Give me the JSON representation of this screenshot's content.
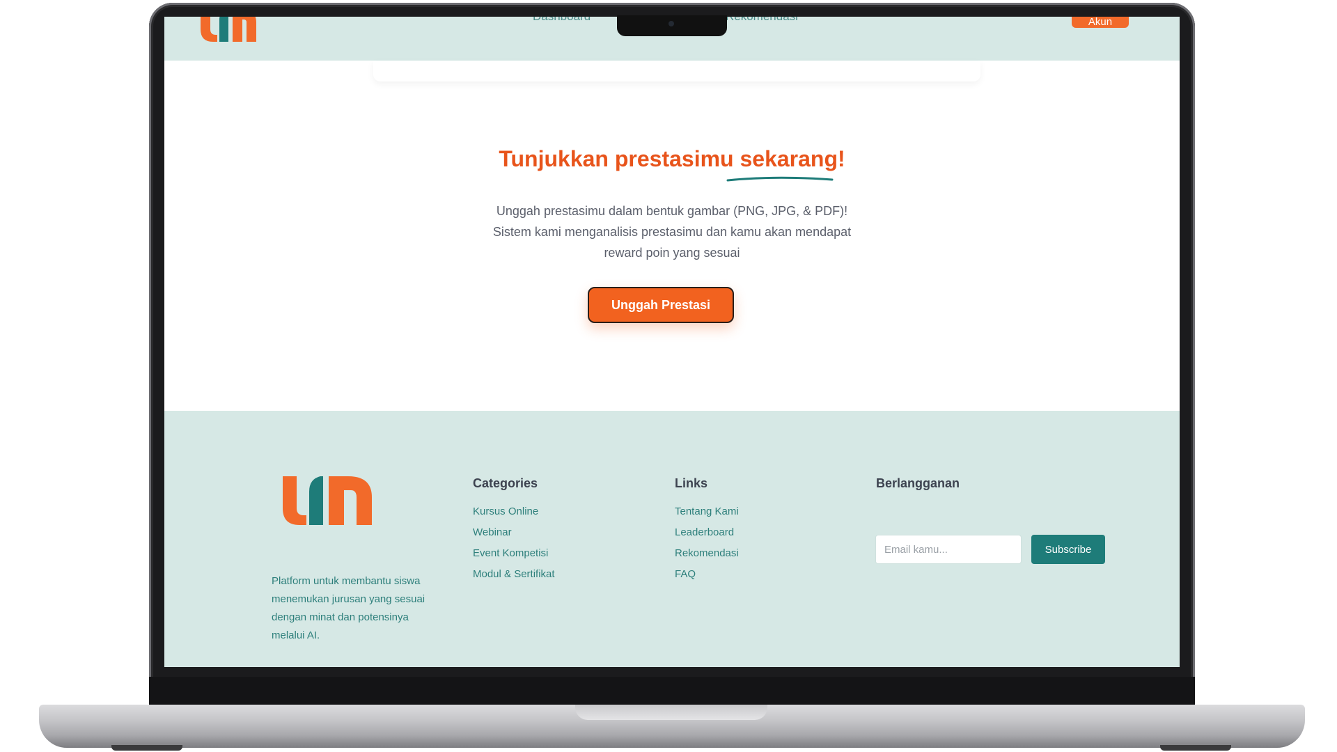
{
  "brand": {
    "logo_letters": "um",
    "colors": {
      "orange": "#f26a2a",
      "teal": "#1e7c79",
      "mint": "#d6e8e5"
    }
  },
  "navbar": {
    "links": [
      "Dashboard",
      "Rekomendasi"
    ],
    "login_label": "Akun"
  },
  "hero": {
    "title": "Tunjukkan prestasimu sekarang!",
    "description_lines": [
      "Unggah prestasimu dalam bentuk gambar (PNG, JPG, & PDF)!",
      "Sistem kami menganalisis prestasimu dan kamu akan mendapat",
      "reward poin yang sesuai"
    ],
    "upload_button": "Unggah Prestasi"
  },
  "footer": {
    "tagline": "Platform untuk membantu siswa menemukan jurusan yang sesuai dengan minat dan potensinya melalui AI.",
    "categories": {
      "title": "Categories",
      "items": [
        "Kursus Online",
        "Webinar",
        "Event Kompetisi",
        "Modul & Sertifikat"
      ]
    },
    "links": {
      "title": "Links",
      "items": [
        "Tentang Kami",
        "Leaderboard",
        "Rekomendasi",
        "FAQ"
      ]
    },
    "subscribe": {
      "title": "Berlangganan",
      "email_placeholder": "Email kamu...",
      "button": "Subscribe"
    }
  }
}
